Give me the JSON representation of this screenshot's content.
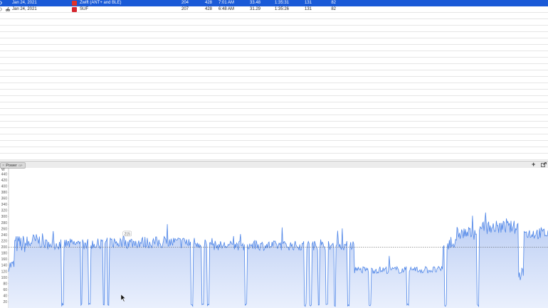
{
  "rides": [
    {
      "date": "Jan 24, 2021",
      "title": "Zwift (ANT+ and BLE)",
      "col_a": "204",
      "col_b": "428",
      "time": "7:01 AM",
      "col_c": "33.48",
      "duration": "1:35:31",
      "col_d": "131",
      "col_e": "82",
      "selected": true,
      "swatch_color": "#e0312b",
      "icon": "chevron-right-icon"
    },
    {
      "date": "Jan 24, 2021",
      "title": "SUF",
      "col_a": "207",
      "col_b": "428",
      "time": "6:48 AM",
      "col_c": "31.29",
      "duration": "1:35:26",
      "col_d": "131",
      "col_e": "82",
      "selected": false,
      "swatch_color": "#d6262e",
      "icon": "cyclist-icon"
    }
  ],
  "chart_panel": {
    "tab_label": "Power",
    "tab_sub": "GP",
    "close_glyph": "×",
    "add_glyph": "+"
  },
  "chart_data": {
    "type": "area",
    "title": "",
    "ylabel_unit": "W",
    "ylim": [
      0,
      460
    ],
    "yticks": [
      20,
      40,
      60,
      80,
      100,
      120,
      140,
      160,
      180,
      200,
      220,
      240,
      260,
      280,
      300,
      320,
      340,
      360,
      380,
      400,
      420,
      440
    ],
    "average_line": 200,
    "annotation": {
      "text": "215",
      "x": 0.22,
      "y": 215
    },
    "color_line": "#4f86e8",
    "color_fill_top": "#b9ccf3",
    "color_fill_bottom": "#eaf0fd",
    "grid": false,
    "segments": [
      {
        "x": [
          0.0,
          0.01
        ],
        "mean": 140,
        "spread": 20
      },
      {
        "x": [
          0.01,
          0.04
        ],
        "mean": 210,
        "spread": 30
      },
      {
        "x": [
          0.04,
          0.065
        ],
        "mean": 220,
        "spread": 25
      },
      {
        "x": [
          0.065,
          0.18
        ],
        "mean": 210,
        "spread": 18
      },
      {
        "x": [
          0.18,
          0.37
        ],
        "mean": 215,
        "spread": 20
      },
      {
        "x": [
          0.37,
          0.64
        ],
        "mean": 205,
        "spread": 16
      },
      {
        "x": [
          0.64,
          0.805
        ],
        "mean": 125,
        "spread": 12
      },
      {
        "x": [
          0.805,
          0.83
        ],
        "mean": 210,
        "spread": 18
      },
      {
        "x": [
          0.83,
          0.875
        ],
        "mean": 245,
        "spread": 22
      },
      {
        "x": [
          0.875,
          0.945
        ],
        "mean": 265,
        "spread": 22
      },
      {
        "x": [
          0.945,
          0.955
        ],
        "mean": 120,
        "spread": 30
      },
      {
        "x": [
          0.955,
          1.0
        ],
        "mean": 245,
        "spread": 20
      }
    ],
    "drops": [
      0.1,
      0.135,
      0.15,
      0.177,
      0.185,
      0.34,
      0.36,
      0.37,
      0.44,
      0.55,
      0.56,
      0.575,
      0.59,
      0.605,
      0.63,
      0.67,
      0.74,
      0.81,
      0.87
    ]
  }
}
